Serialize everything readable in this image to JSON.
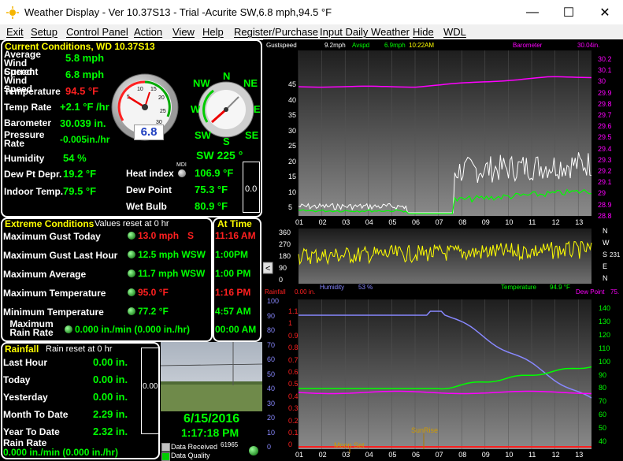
{
  "window": {
    "title": "Weather Display - Ver 10.37S13 - Trial  -Acurite  SW,6.8 mph,94.5 °F",
    "minimize": "—",
    "maximize": "☐",
    "close": "✕"
  },
  "menu": [
    "Exit",
    "Setup",
    "Control Panel",
    "Action",
    "View",
    "Help",
    "Register/Purchase",
    "Input Daily Weather",
    "Hide",
    "WDL"
  ],
  "current": {
    "header": "Current Conditions, WD 10.37S13",
    "avg_wind_label": "Average Wind Speed",
    "avg_wind": "5.8 mph",
    "cur_wind_label": "Current Wind Speed",
    "cur_wind": "6.8 mph",
    "temp_label": "Temperature",
    "temp": "94.5 °F",
    "temp_rate_label": "Temp Rate",
    "temp_rate": "+2.1 °F /hr",
    "baro_label": "Barometer",
    "baro": "30.039 in.",
    "pres_rate_label": "Pressure Rate",
    "pres_rate": "-0.005in./hr",
    "hum_label": "Humidity",
    "hum": "54 %",
    "dew_depr_label": "Dew Pt Depr.",
    "dew_depr": "19.2 °F",
    "indoor_label": "Indoor Temp.",
    "indoor": "79.5 °F",
    "gauge_value": "6.8",
    "compass": {
      "n": "N",
      "ne": "NE",
      "e": "E",
      "se": "SE",
      "s": "S",
      "sw": "SW",
      "w": "W",
      "nw": "NW"
    },
    "dir_text": "SW  225 °",
    "heat_label": "Heat index",
    "heat": "106.9 °F",
    "mdi": "MDI",
    "dewpt_label": "Dew Point",
    "dewpt": "75.3 °F",
    "wetbulb_label": "Wet Bulb",
    "wetbulb": "80.9 °F",
    "side_value": "0.0"
  },
  "extreme": {
    "header": "Extreme Conditions",
    "sub": "Values reset at 0 hr",
    "time_header": "At Time",
    "rows": [
      {
        "label": "Maximum Gust Today",
        "value": "13.0 mph",
        "unit": "S",
        "time": "11:16 AM",
        "color": "r"
      },
      {
        "label": "Maximum Gust Last Hour",
        "value": "12.5 mph WSW",
        "unit": "",
        "time": "1:00PM",
        "color": "g"
      },
      {
        "label": "Maximum Average",
        "value": "11.7 mph WSW",
        "unit": "",
        "time": "1:00 PM",
        "color": "g"
      },
      {
        "label": "Maximum Temperature",
        "value": "95.0 °F",
        "unit": "",
        "time": "1:16 PM",
        "color": "r"
      },
      {
        "label": "Minimum Temperature",
        "value": "77.2 °F",
        "unit": "",
        "time": "4:57 AM",
        "color": "g"
      },
      {
        "label": "Maximum Rain Rate",
        "value": "0.000 in./min (0.000 in./hr)",
        "unit": "",
        "time": "00:00 AM",
        "color": "g"
      }
    ]
  },
  "rain": {
    "header": "Rainfall",
    "sub": "Rain reset at 0 hr",
    "rows": [
      {
        "label": "Last Hour",
        "value": "0.00 in."
      },
      {
        "label": "Today",
        "value": "0.00 in."
      },
      {
        "label": "Yesterday",
        "value": "0.00 in."
      },
      {
        "label": "Month To Date",
        "value": "2.29 in."
      },
      {
        "label": "Year To Date",
        "value": "2.32 in."
      }
    ],
    "rate_label": "Rain Rate",
    "rate": "0.000 in./min (0.000 in./hr)",
    "side_value": "0.00"
  },
  "cam": {
    "date": "6/15/2016",
    "time": "1:17:18 PM",
    "received_label": "Data Received",
    "received": "61965",
    "quality_label": "Data Quality"
  },
  "graph_top": {
    "gust_label": "Gustspeed",
    "gust": "9.2mph",
    "avspd_label": "Avspd",
    "avspd": "6.9mph",
    "time": "10:22AM",
    "baro_label": "Barometer",
    "baro": "30.04in.",
    "y_left": [
      "45",
      "40",
      "35",
      "30",
      "25",
      "20",
      "15",
      "10",
      "5"
    ],
    "y_right": [
      "30.2",
      "30.1",
      "30",
      "29.9",
      "29.8",
      "29.7",
      "29.6",
      "29.5",
      "29.4",
      "29.3",
      "29.2",
      "29.1",
      "29",
      "28.9",
      "28.8"
    ],
    "x": [
      "01",
      "02",
      "03",
      "04",
      "05",
      "06",
      "07",
      "08",
      "09",
      "10",
      "11",
      "12",
      "13"
    ]
  },
  "graph_dir": {
    "y": [
      "360",
      "270",
      "180",
      "90",
      "0"
    ],
    "right": [
      "N",
      "W",
      "S",
      "E",
      "N"
    ],
    "right_val": "231"
  },
  "graph_bot": {
    "rain_label": "Rainfall",
    "rain": "0.00 in.",
    "hum_label": "Humidity",
    "hum": "53 %",
    "temp_label": "Temperature",
    "temp": "94.9 °F",
    "dew_label": "Dew Point",
    "dew": "75.",
    "y_left": [
      "100",
      "90",
      "80",
      "70",
      "60",
      "50",
      "40",
      "30",
      "20",
      "10",
      "0"
    ],
    "y_rain": [
      "1.1",
      "1",
      "0.9",
      "0.8",
      "0.7",
      "0.6",
      "0.5",
      "0.4",
      "0.3",
      "0.2",
      "0.1",
      "0"
    ],
    "y_right": [
      "140",
      "130",
      "120",
      "110",
      "100",
      "90",
      "80",
      "70",
      "60",
      "50",
      "40"
    ],
    "x": [
      "01",
      "02",
      "03",
      "04",
      "05",
      "06",
      "07",
      "08",
      "09",
      "10",
      "11",
      "12",
      "13"
    ],
    "sunrise": "SunRise",
    "moonset": "Moon Set"
  },
  "colors": {
    "accent_green": "#00ff00",
    "accent_red": "#ff2020",
    "yellow": "#ffff00",
    "magenta": "#ff00ff"
  }
}
